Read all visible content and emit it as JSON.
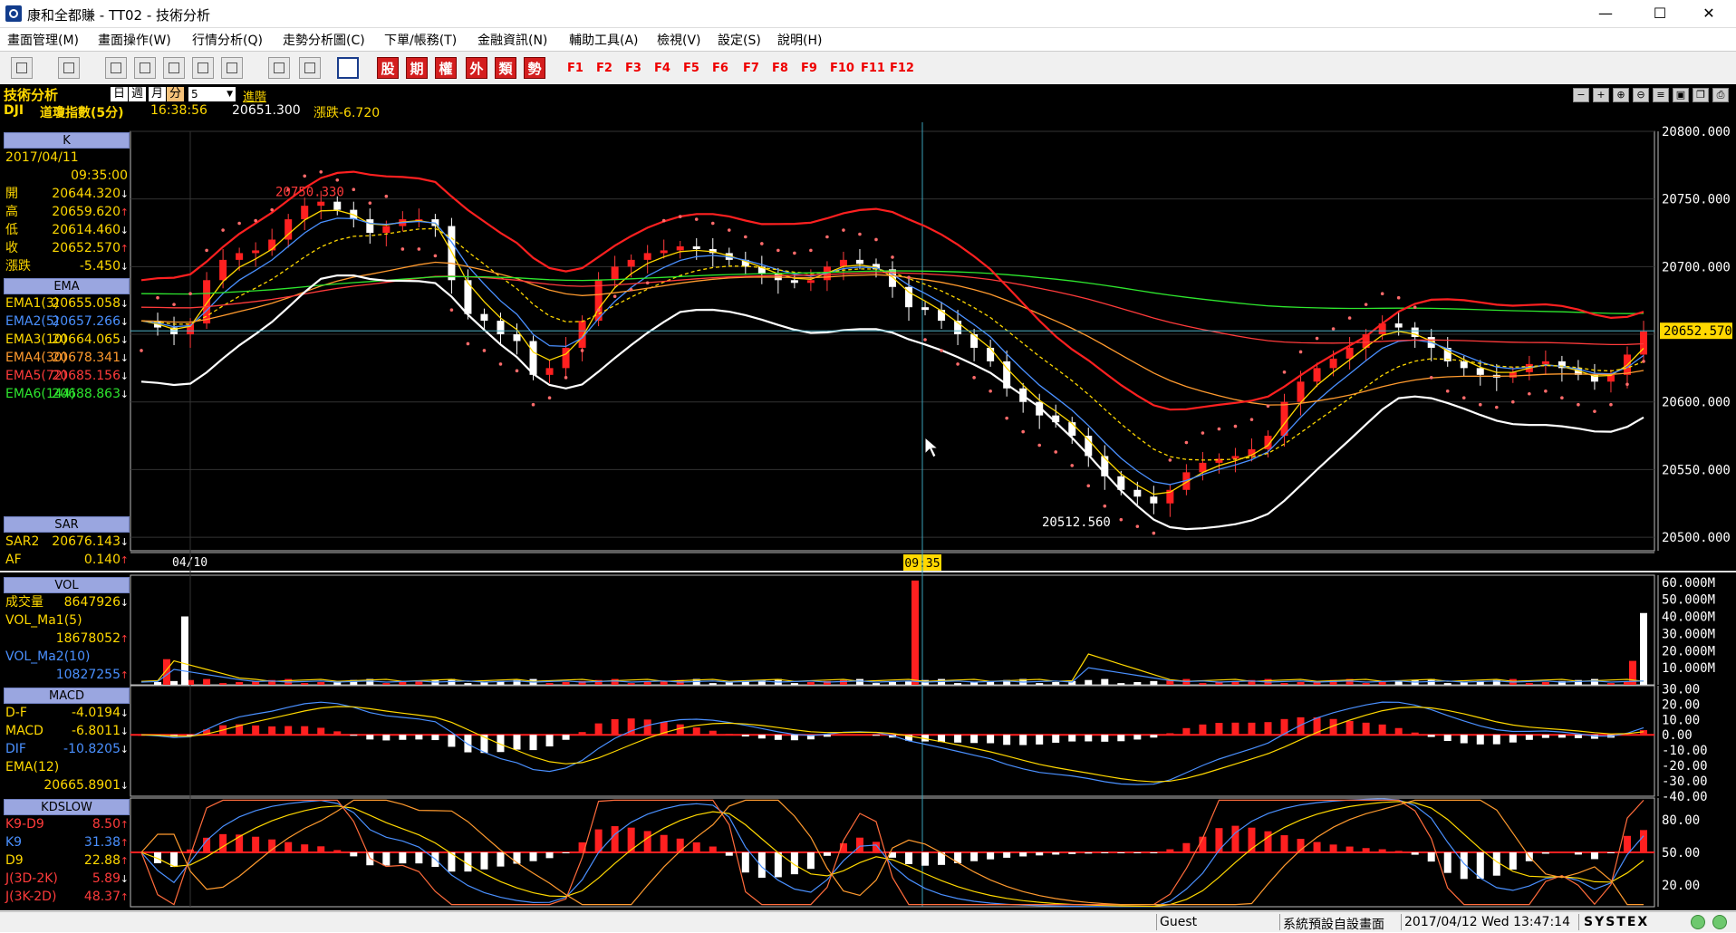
{
  "window": {
    "title": "康和全都賺 - TT02 - 技術分析",
    "minimize": "—",
    "maximize": "☐",
    "close": "✕"
  },
  "menu": [
    "畫面管理(M)",
    "畫面操作(W)",
    "行情分析(Q)",
    "走勢分析圖(C)",
    "下單/帳務(T)",
    "金融資訊(N)",
    "輔助工具(A)",
    "檢視(V)",
    "設定(S)",
    "說明(H)"
  ],
  "toolbar": {
    "red_buttons": [
      "股",
      "期",
      "權",
      "外",
      "類",
      "勢"
    ],
    "fkeys": [
      "F1",
      "F2",
      "F3",
      "F4",
      "F5",
      "F6",
      "F7",
      "F8",
      "F9",
      "F10",
      "F11",
      "F12"
    ]
  },
  "header": {
    "title": "技術分析",
    "periods": [
      "日",
      "週",
      "月",
      "分"
    ],
    "active_period": "分",
    "interval": "5",
    "advanced": "進階",
    "symbol": "DJI",
    "name": "道瓊指數(5分)",
    "time": "16:38:56",
    "price": "20651.300",
    "change": "漲跌-6.720"
  },
  "panels": {
    "k": {
      "title": "K",
      "date": "2017/04/11",
      "time": "09:35:00",
      "rows": [
        {
          "label": "開",
          "value": "20644.320",
          "arrow": "↓"
        },
        {
          "label": "高",
          "value": "20659.620",
          "arrow": "↑"
        },
        {
          "label": "低",
          "value": "20614.460",
          "arrow": "↓"
        },
        {
          "label": "收",
          "value": "20652.570",
          "arrow": "↑"
        },
        {
          "label": "漲跌",
          "value": "-5.450",
          "arrow": "↓"
        }
      ]
    },
    "ema": {
      "title": "EMA",
      "rows": [
        {
          "label": "EMA1(3)",
          "value": "20655.058",
          "arrow": "↓",
          "color": "#ffd800"
        },
        {
          "label": "EMA2(5)",
          "value": "20657.266",
          "arrow": "↓",
          "color": "#4a90ff"
        },
        {
          "label": "EMA3(10)",
          "value": "20664.065",
          "arrow": "↓",
          "color": "#ffd800"
        },
        {
          "label": "EMA4(30)",
          "value": "20678.341",
          "arrow": "↓",
          "color": "#ff9a2e"
        },
        {
          "label": "EMA5(72)",
          "value": "20685.156",
          "arrow": "↓",
          "color": "#ff3b3b"
        },
        {
          "label": "EMA6(144)",
          "value": "20688.863",
          "arrow": "↓",
          "color": "#2ee62e"
        }
      ]
    },
    "sar": {
      "title": "SAR",
      "rows": [
        {
          "label": "SAR2",
          "value": "20676.143",
          "arrow": "↓"
        },
        {
          "label": "AF",
          "value": "0.140",
          "arrow": "↑"
        }
      ]
    },
    "vol": {
      "title": "VOL",
      "rows": [
        {
          "label": "成交量",
          "value": "8647926",
          "arrow": "↓",
          "color": "#ffd800"
        },
        {
          "label": "VOL_Ma1(5)",
          "value": "",
          "arrow": "",
          "color": "#ffd800"
        },
        {
          "label": "",
          "value": "18678052",
          "arrow": "↑",
          "color": "#ffd800"
        },
        {
          "label": "VOL_Ma2(10)",
          "value": "",
          "arrow": "",
          "color": "#4a90ff"
        },
        {
          "label": "",
          "value": "10827255",
          "arrow": "↑",
          "color": "#4a90ff"
        }
      ]
    },
    "macd": {
      "title": "MACD",
      "rows": [
        {
          "label": "D-F",
          "value": "-4.0194",
          "arrow": "↓",
          "color": "#ffd800"
        },
        {
          "label": "MACD",
          "value": "-6.8011",
          "arrow": "↓",
          "color": "#ffd800"
        },
        {
          "label": "DIF",
          "value": "-10.8205",
          "arrow": "↓",
          "color": "#4a90ff"
        },
        {
          "label": "EMA(12)",
          "value": "",
          "arrow": "",
          "color": "#ffd800"
        },
        {
          "label": "",
          "value": "20665.8901",
          "arrow": "↓",
          "color": "#ffd800"
        }
      ]
    },
    "kd": {
      "title": "KDSLOW",
      "rows": [
        {
          "label": "K9-D9",
          "value": "8.50",
          "arrow": "↑",
          "color": "#ff3b3b"
        },
        {
          "label": "K9",
          "value": "31.38",
          "arrow": "↑",
          "color": "#4a90ff"
        },
        {
          "label": "D9",
          "value": "22.88",
          "arrow": "↑",
          "color": "#ffd800"
        },
        {
          "label": "J(3D-2K)",
          "value": "5.89",
          "arrow": "↓",
          "color": "#ff3b3b"
        },
        {
          "label": "J(3K-2D)",
          "value": "48.37",
          "arrow": "↑",
          "color": "#ff3b3b"
        }
      ]
    }
  },
  "chart_data": [
    {
      "type": "candlestick",
      "title": "道瓊指數(5分)",
      "ylim": [
        20490,
        20800
      ],
      "y_ticks": [
        "20500.000",
        "20550.000",
        "20600.000",
        "20650.000",
        "20700.000",
        "20750.000",
        "20800.000"
      ],
      "current_price_label": "20652.570",
      "high_annotation": "20750.330",
      "low_annotation": "20512.560",
      "x_labels": [
        "04/10",
        "09:35"
      ],
      "series": [
        {
          "name": "K",
          "color": "#ffffff"
        },
        {
          "name": "EMA1(3)",
          "color": "#ffd800"
        },
        {
          "name": "EMA2(5)",
          "color": "#4a90ff"
        },
        {
          "name": "EMA3(10)",
          "color": "#ffd800"
        },
        {
          "name": "EMA4(30)",
          "color": "#ff9a2e"
        },
        {
          "name": "EMA5(72)",
          "color": "#ff3b3b"
        },
        {
          "name": "EMA6(144)",
          "color": "#2ee62e"
        },
        {
          "name": "SAR2",
          "color": "#ff3b3b"
        }
      ],
      "close_path": [
        20660,
        20655,
        20650,
        20658,
        20690,
        20705,
        20710,
        20712,
        20720,
        20735,
        20745,
        20748,
        20742,
        20735,
        20725,
        20730,
        20735,
        20735,
        20730,
        20690,
        20665,
        20660,
        20650,
        20645,
        20620,
        20625,
        20640,
        20660,
        20690,
        20700,
        20705,
        20710,
        20712,
        20715,
        20713,
        20710,
        20705,
        20700,
        20695,
        20690,
        20688,
        20690,
        20700,
        20705,
        20702,
        20698,
        20685,
        20670,
        20668,
        20660,
        20650,
        20640,
        20630,
        20610,
        20600,
        20590,
        20585,
        20575,
        20560,
        20545,
        20535,
        20530,
        20525,
        20535,
        20548,
        20555,
        20558,
        20560,
        20565,
        20575,
        20600,
        20615,
        20625,
        20632,
        20640,
        20650,
        20658,
        20655,
        20648,
        20640,
        20630,
        20625,
        20620,
        20618,
        20622,
        20628,
        20630,
        20625,
        20620,
        20615,
        20620,
        20635,
        20652
      ]
    },
    {
      "type": "bar",
      "title": "VOL",
      "y_ticks": [
        "10.000M",
        "20.000M",
        "30.000M",
        "40.000M",
        "50.000M",
        "60.000M"
      ],
      "ylim": [
        0,
        62
      ],
      "unit": "M",
      "spikes": [
        {
          "x": "04/10",
          "value": 40
        },
        {
          "x": "09:35",
          "value": 61
        },
        {
          "x": "last",
          "value": 42
        }
      ]
    },
    {
      "type": "bar",
      "title": "MACD",
      "y_ticks": [
        "30.00",
        "20.00",
        "10.00",
        "0.00",
        "-10.00",
        "-20.00",
        "-30.00",
        "-40.00"
      ],
      "ylim": [
        -40,
        32
      ]
    },
    {
      "type": "bar",
      "title": "KDSLOW",
      "y_ticks": [
        "80.00",
        "50.00",
        "20.00"
      ],
      "ylim": [
        0,
        100
      ]
    }
  ],
  "status": {
    "user": "Guest",
    "screen": "系統預設自設畫面",
    "datetime": "2017/04/12 Wed 13:47:14",
    "brand": "SYSTEX"
  }
}
